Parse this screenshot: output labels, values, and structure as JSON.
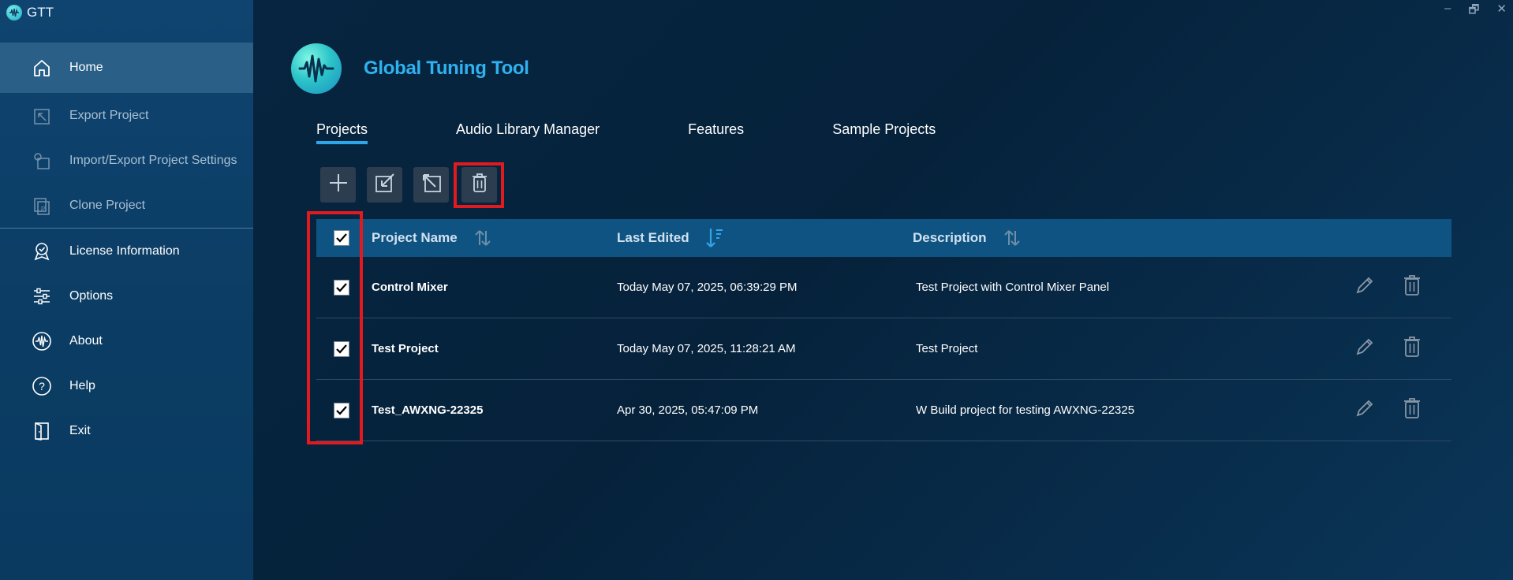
{
  "app": {
    "short_title": "GTT",
    "brand_title": "Global Tuning Tool",
    "window_controls": [
      "–",
      "🗗",
      "✕"
    ]
  },
  "sidebar": {
    "items": [
      {
        "label": "Home",
        "icon": "home-icon",
        "state": "active"
      },
      {
        "label": "Export Project",
        "icon": "export-project-icon",
        "state": "disabled"
      },
      {
        "label": "Import/Export Project Settings",
        "icon": "import-export-settings-icon",
        "state": "disabled"
      },
      {
        "label": "Clone Project",
        "icon": "clone-project-icon",
        "state": "disabled"
      },
      {
        "label": "License Information",
        "icon": "license-badge-icon",
        "state": "normal"
      },
      {
        "label": "Options",
        "icon": "sliders-icon",
        "state": "normal"
      },
      {
        "label": "About",
        "icon": "about-waveform-icon",
        "state": "normal"
      },
      {
        "label": "Help",
        "icon": "help-icon",
        "state": "normal"
      },
      {
        "label": "Exit",
        "icon": "exit-door-icon",
        "state": "normal"
      }
    ]
  },
  "tabs": [
    {
      "label": "Projects",
      "active": true
    },
    {
      "label": "Audio Library Manager",
      "active": false
    },
    {
      "label": "Features",
      "active": false
    },
    {
      "label": "Sample Projects",
      "active": false
    }
  ],
  "toolbar": {
    "buttons": [
      "add-icon",
      "import-icon",
      "export-icon",
      "trash-icon"
    ]
  },
  "table": {
    "columns": [
      {
        "label": "Project Name",
        "sort": "sortable"
      },
      {
        "label": "Last Edited",
        "sort": "descending"
      },
      {
        "label": "Description",
        "sort": "sortable"
      }
    ],
    "header_checked": true,
    "rows": [
      {
        "checked": true,
        "name": "Control Mixer",
        "edited": "Today May 07, 2025, 06:39:29 PM",
        "description": "Test Project with Control Mixer Panel"
      },
      {
        "checked": true,
        "name": "Test Project",
        "edited": "Today May 07, 2025, 11:28:21 AM",
        "description": "Test Project"
      },
      {
        "checked": true,
        "name": "Test_AWXNG-22325",
        "edited": "Apr 30, 2025, 05:47:09 PM",
        "description": "W Build project for testing AWXNG-22325"
      }
    ]
  },
  "colors": {
    "accent": "#2ea7ea",
    "highlight": "#e11a1f",
    "sidebar": "#0f4470",
    "header": "#0f5382"
  }
}
